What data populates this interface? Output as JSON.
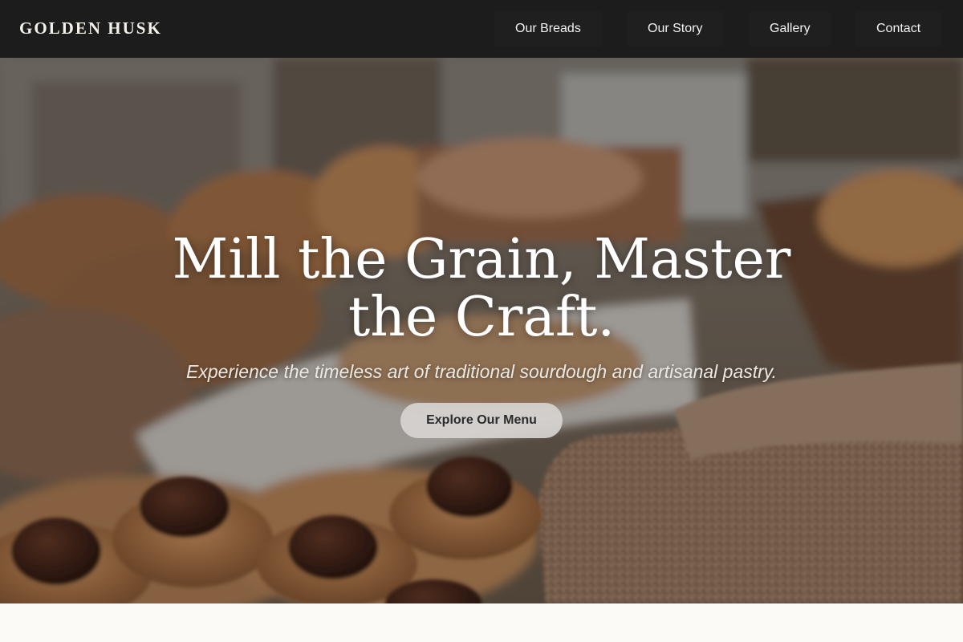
{
  "brand": {
    "name": "GOLDEN HUSK"
  },
  "nav": {
    "items": [
      {
        "label": "Our Breads"
      },
      {
        "label": "Our Story"
      },
      {
        "label": "Gallery"
      },
      {
        "label": "Contact"
      }
    ]
  },
  "hero": {
    "title": "Mill the Grain, Master the Craft.",
    "subtitle": "Experience the timeless art of traditional sourdough and artisanal pastry.",
    "cta_label": "Explore Our Menu"
  },
  "colors": {
    "nav_background": "#1c1c1c",
    "nav_text": "#f2f2f2",
    "hero_title": "#ffffff",
    "cta_background": "#d7d4d0",
    "cta_text": "#2b2b2b",
    "page_background": "#fbfaf6"
  }
}
